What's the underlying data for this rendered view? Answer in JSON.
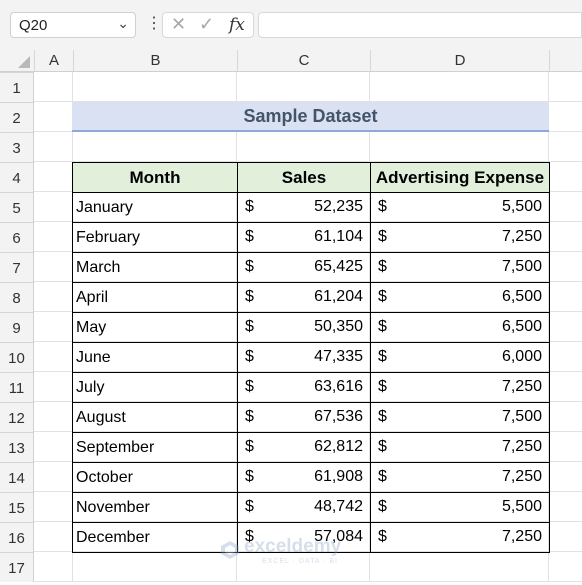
{
  "formula_bar": {
    "name_box": "Q20",
    "cancel_glyph": "✕",
    "enter_glyph": "✓",
    "fx_label": "fx",
    "formula": ""
  },
  "columns": [
    "A",
    "B",
    "C",
    "D"
  ],
  "rows": [
    "1",
    "2",
    "3",
    "4",
    "5",
    "6",
    "7",
    "8",
    "9",
    "10",
    "11",
    "12",
    "13",
    "14",
    "15",
    "16",
    "17"
  ],
  "title": "Sample Dataset",
  "table": {
    "headers": [
      "Month",
      "Sales",
      "Advertising Expense"
    ],
    "currency": "$",
    "rows": [
      {
        "month": "January",
        "sales": "52,235",
        "expense": "5,500"
      },
      {
        "month": "February",
        "sales": "61,104",
        "expense": "7,250"
      },
      {
        "month": "March",
        "sales": "65,425",
        "expense": "7,500"
      },
      {
        "month": "April",
        "sales": "61,204",
        "expense": "6,500"
      },
      {
        "month": "May",
        "sales": "50,350",
        "expense": "6,500"
      },
      {
        "month": "June",
        "sales": "47,335",
        "expense": "6,000"
      },
      {
        "month": "July",
        "sales": "63,616",
        "expense": "7,250"
      },
      {
        "month": "August",
        "sales": "67,536",
        "expense": "7,500"
      },
      {
        "month": "September",
        "sales": "62,812",
        "expense": "7,250"
      },
      {
        "month": "October",
        "sales": "61,908",
        "expense": "7,250"
      },
      {
        "month": "November",
        "sales": "48,742",
        "expense": "5,500"
      },
      {
        "month": "December",
        "sales": "57,084",
        "expense": "7,250"
      }
    ]
  },
  "watermark": {
    "name": "exceldemy",
    "tagline": "EXCEL · DATA · BI"
  },
  "colors": {
    "title_fill": "#d9e1f2",
    "title_text": "#44546a",
    "header_fill": "#e2efda"
  }
}
